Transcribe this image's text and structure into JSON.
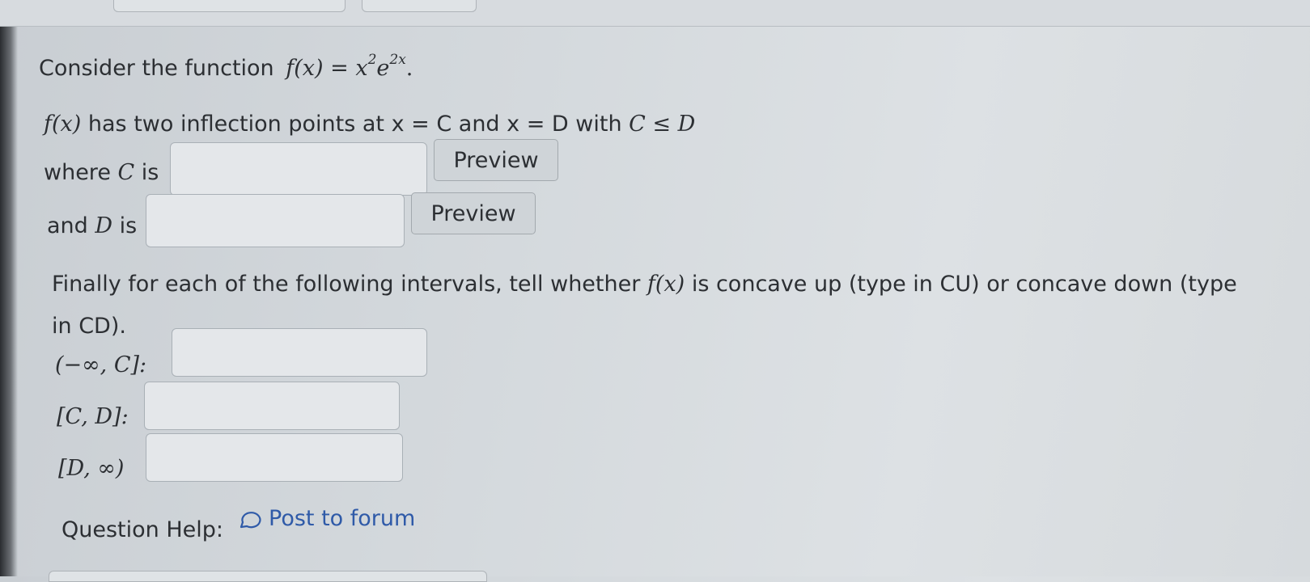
{
  "intro": {
    "text": "Consider the function",
    "formula": "f(x) = x",
    "exp2": "2",
    "e": "e",
    "exp2x": "2x",
    "period": "."
  },
  "inflection": {
    "fx": "f(x)",
    "text": "has two inflection points at x = C and x = D with",
    "relation": "C ≤ D"
  },
  "c_row": {
    "prefix": "where",
    "var": "C",
    "suffix": "is",
    "value": "",
    "preview_label": "Preview"
  },
  "d_row": {
    "prefix": "and",
    "var": "D",
    "suffix": "is",
    "value": "",
    "preview_label": "Preview"
  },
  "concavity": {
    "text_a": "Finally for each of the following intervals, tell whether",
    "fx": "f(x)",
    "text_b": "is concave up (type in CU) or concave down (type",
    "text_c": "in CD).",
    "intervals": [
      {
        "label": "(−∞, C]:",
        "value": ""
      },
      {
        "label": "[C, D]:",
        "value": ""
      },
      {
        "label": "[D, ∞)",
        "value": ""
      }
    ]
  },
  "help": {
    "label": "Question Help:",
    "icon": "chat-bubble-icon",
    "link": "Post to forum"
  }
}
